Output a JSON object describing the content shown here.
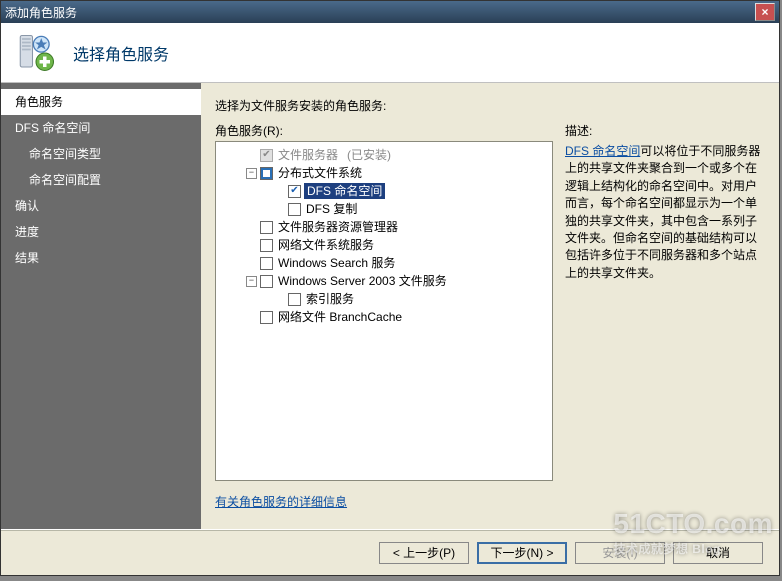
{
  "window_title": "添加角色服务",
  "header": {
    "title": "选择角色服务"
  },
  "sidebar": {
    "items": [
      {
        "label": "角色服务",
        "indent": 0,
        "active": true
      },
      {
        "label": "DFS 命名空间",
        "indent": 0,
        "active": false
      },
      {
        "label": "命名空间类型",
        "indent": 1,
        "active": false
      },
      {
        "label": "命名空间配置",
        "indent": 1,
        "active": false
      },
      {
        "label": "确认",
        "indent": 0,
        "active": false
      },
      {
        "label": "进度",
        "indent": 0,
        "active": false
      },
      {
        "label": "结果",
        "indent": 0,
        "active": false
      }
    ]
  },
  "main": {
    "prompt": "选择为文件服务安装的角色服务:",
    "tree_label": "角色服务(R):",
    "tree": [
      {
        "depth": 0,
        "expand": "none",
        "chk": "grey-checked",
        "label": "文件服务器",
        "suffix": "(已安装)",
        "disabled": true
      },
      {
        "depth": 0,
        "expand": "minus",
        "chk": "mixed",
        "label": "分布式文件系统"
      },
      {
        "depth": 1,
        "expand": "none",
        "chk": "checked",
        "label": "DFS 命名空间",
        "selected": true
      },
      {
        "depth": 1,
        "expand": "none",
        "chk": "unchecked",
        "label": "DFS 复制"
      },
      {
        "depth": 0,
        "expand": "none",
        "chk": "unchecked",
        "label": "文件服务器资源管理器"
      },
      {
        "depth": 0,
        "expand": "none",
        "chk": "unchecked",
        "label": "网络文件系统服务"
      },
      {
        "depth": 0,
        "expand": "none",
        "chk": "unchecked",
        "label": "Windows Search 服务"
      },
      {
        "depth": 0,
        "expand": "minus",
        "chk": "unchecked",
        "label": "Windows Server 2003 文件服务"
      },
      {
        "depth": 1,
        "expand": "none",
        "chk": "unchecked",
        "label": "索引服务"
      },
      {
        "depth": 0,
        "expand": "none",
        "chk": "unchecked",
        "label": "网络文件 BranchCache"
      }
    ],
    "desc_heading": "描述:",
    "desc_link": "DFS 命名空间",
    "desc_body": "可以将位于不同服务器上的共享文件夹聚合到一个或多个在逻辑上结构化的命名空间中。对用户而言，每个命名空间都显示为一个单独的共享文件夹，其中包含一系列子文件夹。但命名空间的基础结构可以包括许多位于不同服务器和多个站点上的共享文件夹。",
    "info_link": "有关角色服务的详细信息"
  },
  "buttons": {
    "prev": "< 上一步(P)",
    "next": "下一步(N) >",
    "install": "安装(I)",
    "cancel": "取消"
  },
  "watermark": {
    "main": "51CTO.com",
    "sub": "技术成就梦想  Blog"
  }
}
